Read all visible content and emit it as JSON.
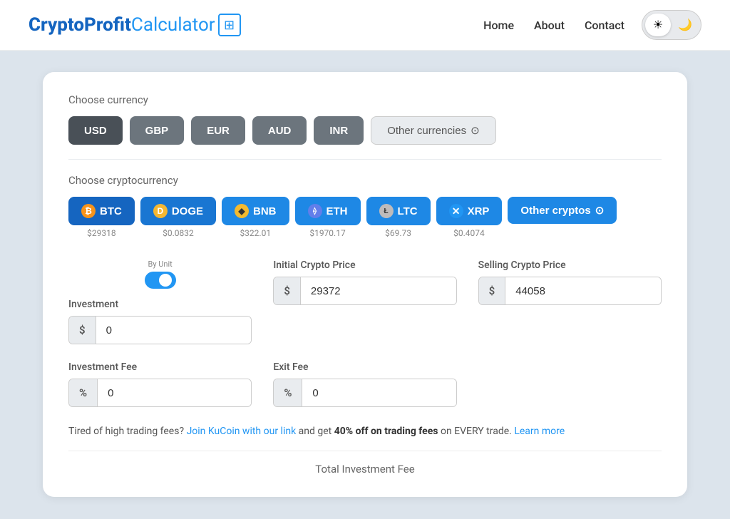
{
  "nav": {
    "logo": {
      "crypto": "Crypto",
      "profit": "Profit",
      "calculator": "Calculator",
      "icon": "⊞"
    },
    "links": [
      "Home",
      "About",
      "Contact"
    ],
    "theme": {
      "light_icon": "☀",
      "dark_icon": "🌙"
    }
  },
  "currency": {
    "label": "Choose currency",
    "buttons": [
      "USD",
      "GBP",
      "EUR",
      "AUD",
      "INR"
    ],
    "other_label": "Other currencies",
    "other_icon": "⊙"
  },
  "crypto": {
    "label": "Choose cryptocurrency",
    "coins": [
      {
        "key": "btc",
        "label": "BTC",
        "icon": "₿",
        "icon_class": "coin-btc",
        "price": "$29318"
      },
      {
        "key": "doge",
        "label": "DOGE",
        "icon": "D",
        "icon_class": "coin-doge",
        "price": "$0.0832"
      },
      {
        "key": "bnb",
        "label": "BNB",
        "icon": "◆",
        "icon_class": "coin-bnb",
        "price": "$322.01"
      },
      {
        "key": "eth",
        "label": "ETH",
        "icon": "⟠",
        "icon_class": "coin-eth",
        "price": "$1970.17"
      },
      {
        "key": "ltc",
        "label": "LTC",
        "icon": "Ł",
        "icon_class": "coin-ltc",
        "price": "$69.73"
      },
      {
        "key": "xrp",
        "label": "XRP",
        "icon": "✕",
        "icon_class": "coin-xrp",
        "price": "$0.4074"
      }
    ],
    "other_label": "Other cryptos",
    "other_icon": "⊙"
  },
  "form": {
    "by_unit_label": "By Unit",
    "investment": {
      "label": "Investment",
      "prefix": "$",
      "value": "0"
    },
    "initial_price": {
      "label": "Initial Crypto Price",
      "prefix": "$",
      "value": "29372"
    },
    "selling_price": {
      "label": "Selling Crypto Price",
      "prefix": "$",
      "value": "44058"
    },
    "investment_fee": {
      "label": "Investment Fee",
      "prefix": "%",
      "value": "0"
    },
    "exit_fee": {
      "label": "Exit Fee",
      "prefix": "%",
      "value": "0"
    }
  },
  "promo": {
    "text_before": "Tired of high trading fees?",
    "link1_text": "Join KuCoin with our link",
    "text_middle": "and get",
    "bold_text": "40% off on trading fees",
    "text_after": "on EVERY trade.",
    "link2_text": "Learn more"
  },
  "total": {
    "label": "Total Investment Fee"
  }
}
